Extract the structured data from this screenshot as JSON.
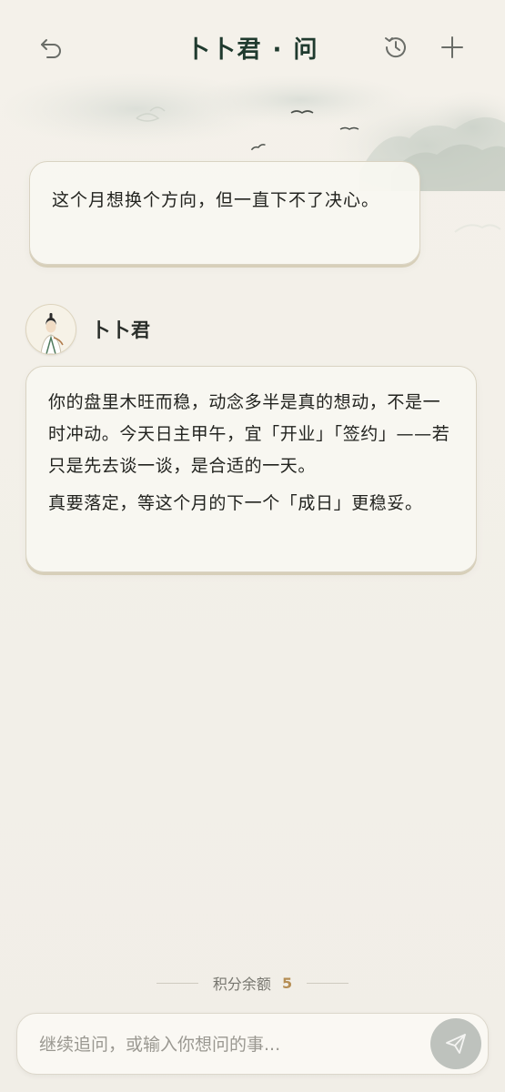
{
  "header": {
    "title": "卜卜君 · 问",
    "back_icon": "back-arrow-icon",
    "history_icon": "history-clock-icon",
    "new_icon": "plus-icon"
  },
  "messages": {
    "user": {
      "text": "这个月想换个方向，但一直下不了决心。"
    },
    "bot": {
      "name": "卜卜君",
      "avatar_icon": "scholar-avatar-icon",
      "paragraphs": [
        "你的盘里木旺而稳，动念多半是真的想动，不是一时冲动。今天日主甲午，宜「开业」「签约」——若只是先去谈一谈，是合适的一天。",
        "真要落定，等这个月的下一个「成日」更稳妥。"
      ]
    }
  },
  "credits": {
    "label": "积分余额",
    "value": "5"
  },
  "input": {
    "placeholder": "继续追问，或输入你想问的事...",
    "value": "",
    "send_icon": "send-paper-plane-icon"
  },
  "colors": {
    "background": "#f2efe8",
    "title": "#1f3a2e",
    "accent": "#b58e55",
    "send_button": "#bec2bd"
  }
}
